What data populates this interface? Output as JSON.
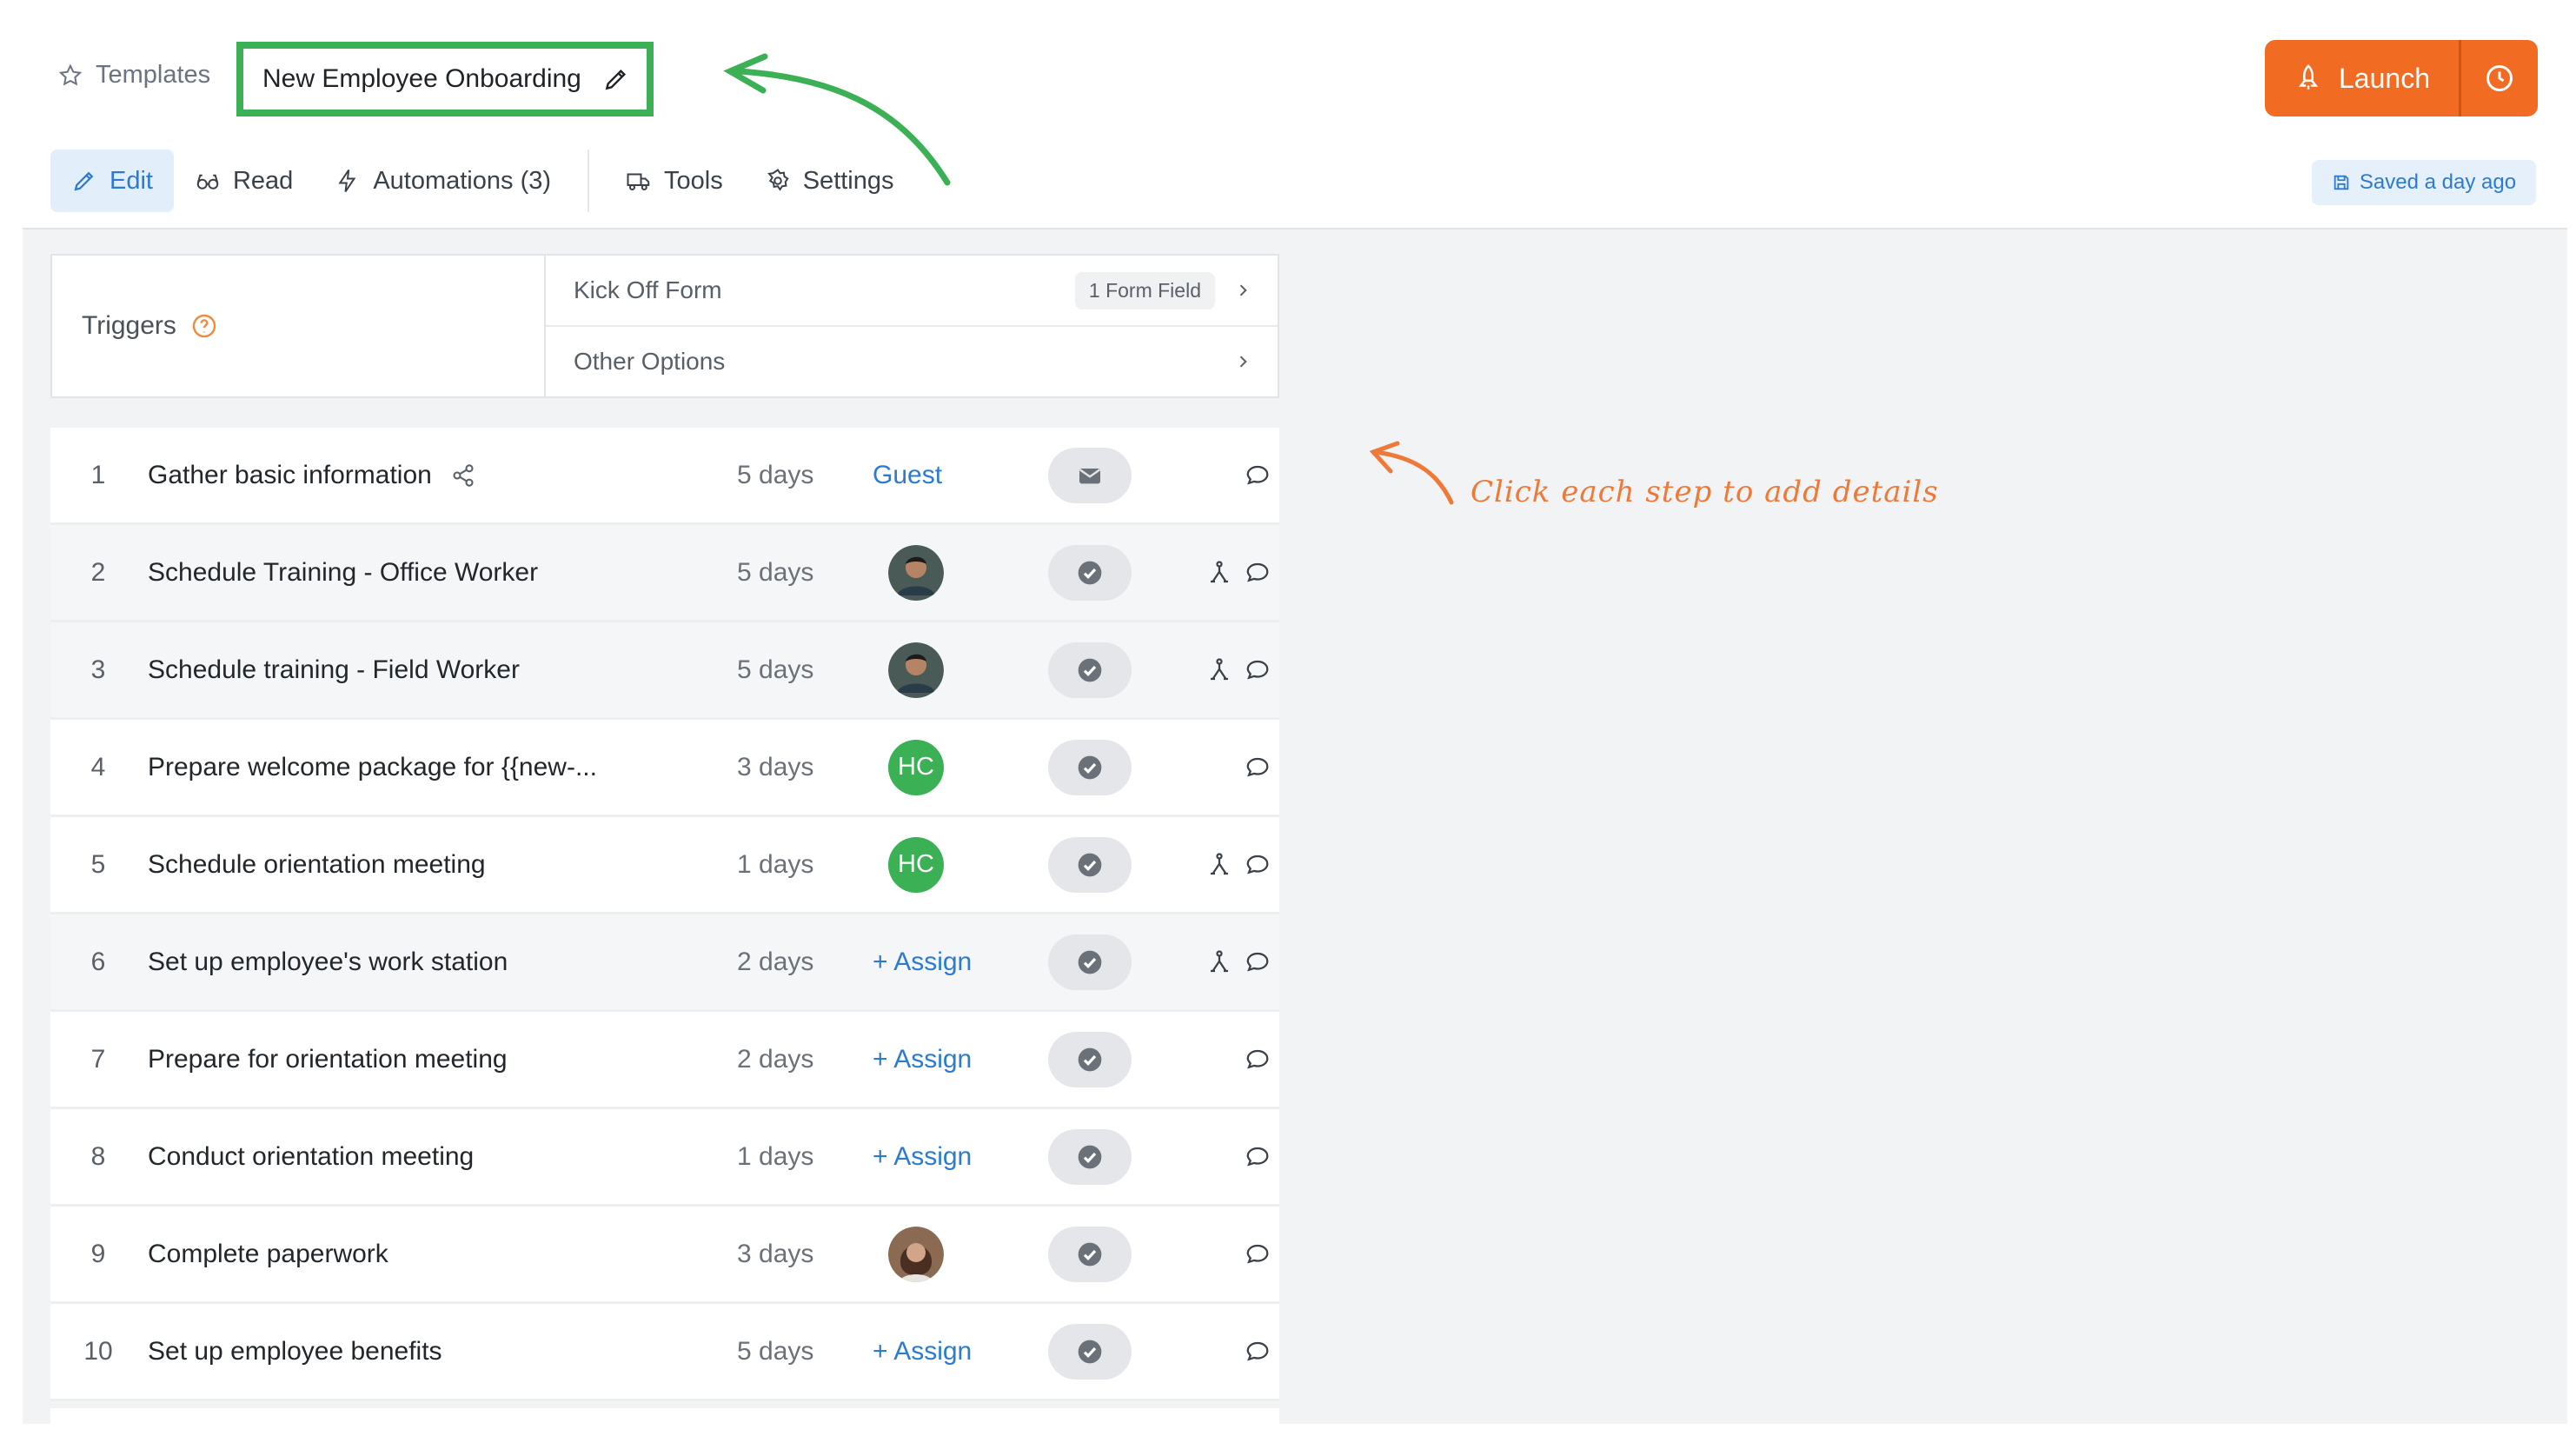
{
  "header": {
    "breadcrumb_label": "Templates",
    "template_title": "New Employee Onboarding",
    "launch_label": "Launch",
    "saved_status": "Saved a day ago",
    "tabs": [
      {
        "label": "Edit",
        "icon": "pencil-icon",
        "active": true
      },
      {
        "label": "Read",
        "icon": "glasses-icon"
      },
      {
        "label": "Automations (3)",
        "icon": "bolt-icon"
      },
      {
        "label": "Tools",
        "icon": "truck-icon"
      },
      {
        "label": "Settings",
        "icon": "gear-icon"
      }
    ]
  },
  "triggers": {
    "label": "Triggers",
    "kickoff_label": "Kick Off Form",
    "kickoff_badge": "1 Form Field",
    "other_label": "Other Options"
  },
  "steps": [
    {
      "num": "1",
      "name": "Gather basic information",
      "duration": "5 days",
      "assignee_type": "text",
      "assignee": "Guest",
      "status": "mail"
    },
    {
      "num": "2",
      "name": "Schedule Training - Office Worker",
      "duration": "5 days",
      "assignee_type": "photo",
      "status": "check",
      "branch": true
    },
    {
      "num": "3",
      "name": "Schedule training - Field Worker",
      "duration": "5 days",
      "assignee_type": "photo",
      "status": "check",
      "branch": true
    },
    {
      "num": "4",
      "name": "Prepare welcome package for {{new-...",
      "duration": "3 days",
      "assignee_type": "initials",
      "assignee": "HC",
      "status": "check"
    },
    {
      "num": "5",
      "name": "Schedule orientation meeting",
      "duration": "1 days",
      "assignee_type": "initials",
      "assignee": "HC",
      "status": "check",
      "branch": true
    },
    {
      "num": "6",
      "name": "Set up employee's work station",
      "duration": "2 days",
      "assignee_type": "assign",
      "assignee": "+ Assign",
      "status": "check",
      "branch": true
    },
    {
      "num": "7",
      "name": "Prepare for orientation meeting",
      "duration": "2 days",
      "assignee_type": "assign",
      "assignee": "+ Assign",
      "status": "check"
    },
    {
      "num": "8",
      "name": "Conduct orientation meeting",
      "duration": "1 days",
      "assignee_type": "assign",
      "assignee": "+ Assign",
      "status": "check"
    },
    {
      "num": "9",
      "name": "Complete paperwork",
      "duration": "3 days",
      "assignee_type": "photo2",
      "status": "check"
    },
    {
      "num": "10",
      "name": "Set up employee benefits",
      "duration": "5 days",
      "assignee_type": "assign",
      "assignee": "+ Assign",
      "status": "check"
    }
  ],
  "hint_text": "Click each step to add details",
  "colors": {
    "accent": "#2b7bd3",
    "launch": "#f26b22",
    "highlight": "#3cb054",
    "hint": "#ee7a3a"
  }
}
